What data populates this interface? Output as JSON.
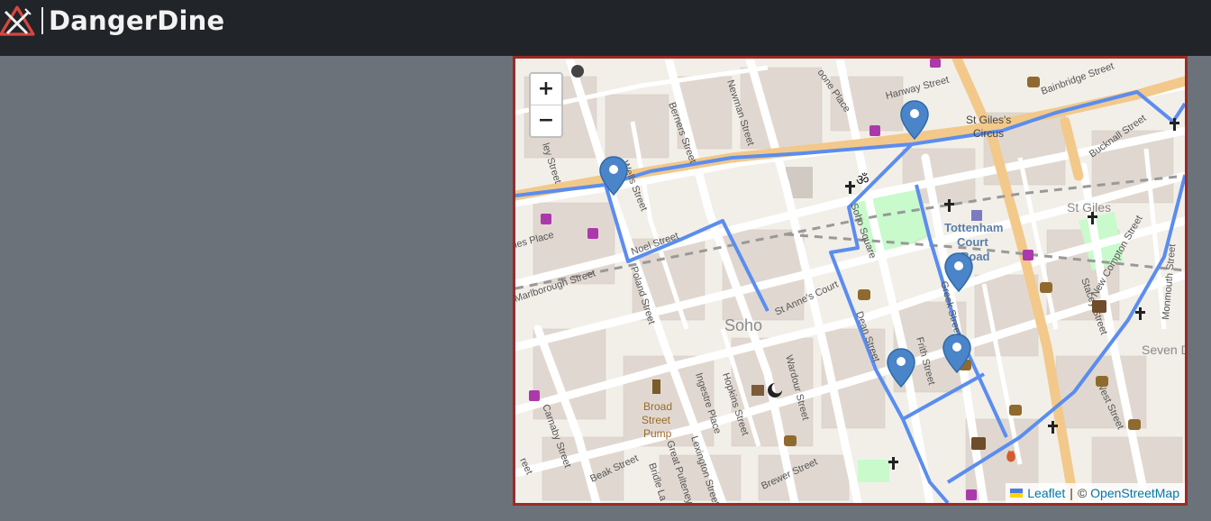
{
  "navbar": {
    "brand_name": "DangerDine",
    "logo_icon": "crossed-knife-fork-warning-icon"
  },
  "map": {
    "zoom_in_label": "+",
    "zoom_out_label": "−",
    "attribution": {
      "leaflet_label": "Leaflet",
      "separator": "|",
      "copyright": "©",
      "osm_label": "OpenStreetMap"
    },
    "route_color": "#5b8def",
    "marker_color": "#4a84c9",
    "marker_count": 5,
    "labels": {
      "soho": "Soho",
      "tottenham_1": "Tottenham",
      "tottenham_2": "Court",
      "tottenham_3": "Road",
      "st_giles_circus_1": "St Giles's",
      "st_giles_circus_2": "Circus",
      "st_giles": "St Giles",
      "seven_dials": "Seven Di",
      "broad_1": "Broad",
      "broad_2": "Street",
      "broad_3": "Pump",
      "streets": {
        "wells": "Wells Street",
        "berners": "Berners Street",
        "newman": "Newman Street",
        "hanway": "Hanway Street",
        "bainbridge": "Bainbridge Street",
        "bucknall": "Bucknall Street",
        "noel": "Noel Street",
        "poland": "Poland Street",
        "marlborough": "Marlborough Street",
        "st_annes": "St Anne's Court",
        "wardour": "Wardour Street",
        "frith": "Frith Street",
        "greek": "Greek Street",
        "dean": "Dean Street",
        "soho_square": "Soho Square",
        "stacey": "Stacey Street",
        "new_compton": "New Compton Street",
        "monmouth": "Monmouth Street",
        "west": "West Street",
        "carnaby": "Carnaby Street",
        "ingestre": "Ingestre Place",
        "hopkins": "Hopkins Street",
        "lexington": "Lexington Street",
        "great_pulteney": "Great Pulteney",
        "bridle": "Bridle La",
        "beak": "Beak Street",
        "brewer": "Brewer Street",
        "oone_place": "oone Place",
        "ies_place": "ies Place",
        "ley_street": "ley Street",
        "reet": "reet"
      }
    }
  }
}
